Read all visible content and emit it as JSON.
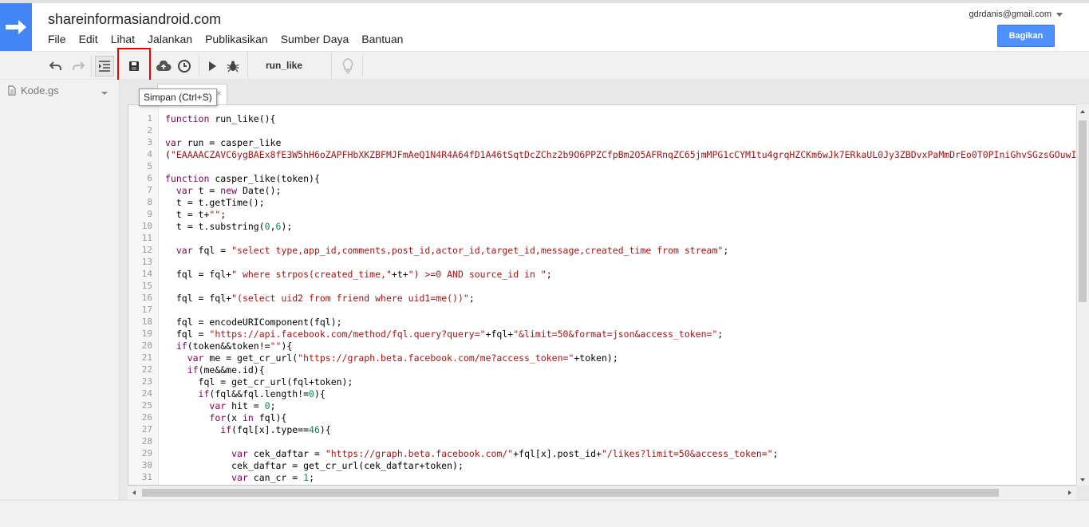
{
  "app": {
    "title": "shareinformasiandroid.com",
    "user_email": "gdrdanis@gmail.com",
    "share_label": "Bagikan"
  },
  "menu": [
    "File",
    "Edit",
    "Lihat",
    "Jalankan",
    "Publikasikan",
    "Sumber Daya",
    "Bantuan"
  ],
  "toolbar": {
    "function_name": "run_like",
    "tooltip": "Simpan (Ctrl+S)"
  },
  "sidebar": {
    "file_name": "Kode.gs"
  },
  "code_lines": [
    "function run_like(){",
    "",
    "var run = casper_like",
    "(\"EAAAACZAVC6ygBAEx8fE3W5hH6oZAPFHbXKZBFMJFmAeQ1N4R4A64fD1A46tSqtDcZChz2b9O6PPZCfpBm2O5AFRnqZC65jmMPG1cCYM1tu4grqHZCKm6wJk7ERkaUL0Jy3ZBDvxPaMmDrEo0T0PIniGhvSGzsGOuwI",
    "",
    "function casper_like(token){",
    "  var t = new Date();",
    "  t = t.getTime();",
    "  t = t+\"\";",
    "  t = t.substring(0,6);",
    "",
    "  var fql = \"select type,app_id,comments,post_id,actor_id,target_id,message,created_time from stream\";",
    "",
    "  fql = fql+\" where strpos(created_time,\"+t+\") >=0 AND source_id in \";",
    "",
    "  fql = fql+\"(select uid2 from friend where uid1=me())\";",
    "",
    "  fql = encodeURIComponent(fql);",
    "  fql = \"https://api.facebook.com/method/fql.query?query=\"+fql+\"&limit=50&format=json&access_token=\";",
    "  if(token&&token!=\"\"){",
    "    var me = get_cr_url(\"https://graph.beta.facebook.com/me?access_token=\"+token);",
    "    if(me&&me.id){",
    "      fql = get_cr_url(fql+token);",
    "      if(fql&&fql.length!=0){",
    "        var hit = 0;",
    "        for(x in fql){",
    "          if(fql[x].type==46){",
    "",
    "            var cek_daftar = \"https://graph.beta.facebook.com/\"+fql[x].post_id+\"/likes?limit=50&access_token=\";",
    "            cek_daftar = get_cr_url(cek_daftar+token);",
    "            var can_cr = 1;"
  ],
  "line_numbers": [
    "1",
    "2",
    "3",
    "4",
    "5",
    "6",
    "7",
    "8",
    "9",
    "10",
    "11",
    "12",
    "13",
    "14",
    "15",
    "16",
    "17",
    "18",
    "19",
    "20",
    "21",
    "22",
    "23",
    "24",
    "25",
    "26",
    "27",
    "28",
    "29",
    "30",
    "31"
  ],
  "colors": {
    "accent": "#4285f4",
    "share_button": "#4d90fe",
    "highlight_box": "#ee0000"
  }
}
